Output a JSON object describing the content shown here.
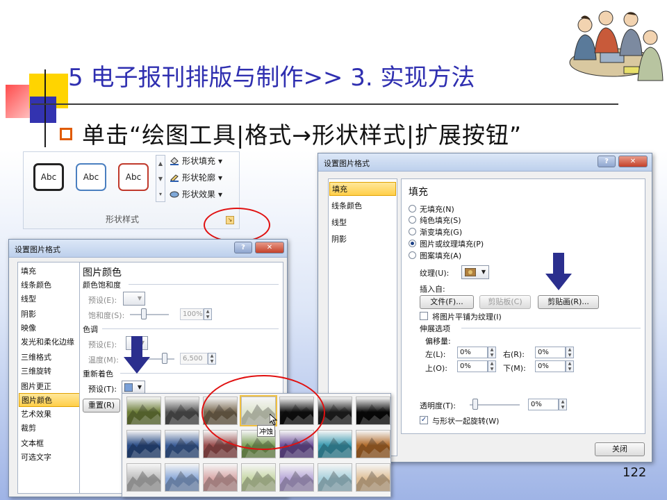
{
  "slide": {
    "title": "5 电子报刊排版与制作>> 3. 实现方法",
    "bullet": "单击“绘图工具|格式→形状样式|扩展按钮”",
    "page_number": "122"
  },
  "ribbon": {
    "style_samples": [
      "Abc",
      "Abc",
      "Abc"
    ],
    "fill_label": "形状填充",
    "outline_label": "形状轮廓",
    "effects_label": "形状效果",
    "group_label": "形状样式",
    "dropdown_glyph": "▾"
  },
  "dialog_right": {
    "title": "设置图片格式",
    "nav": [
      "填充",
      "线条颜色",
      "线型",
      "阴影"
    ],
    "section_title": "填充",
    "radios": [
      {
        "label": "无填充(N)",
        "checked": false
      },
      {
        "label": "纯色填充(S)",
        "checked": false
      },
      {
        "label": "渐变填充(G)",
        "checked": false
      },
      {
        "label": "图片或纹理填充(P)",
        "checked": true
      },
      {
        "label": "图案填充(A)",
        "checked": false
      }
    ],
    "texture_label": "纹理(U):",
    "insert_from_label": "插入自:",
    "file_button": "文件(F)...",
    "clipboard_button": "剪贴板(C)",
    "clipart_button": "剪贴画(R)...",
    "tile_label": "将图片平铺为纹理(I)",
    "stretch_label": "伸展选项",
    "offset_label": "偏移量:",
    "left_label": "左(L):",
    "right_label": "右(R):",
    "top_label": "上(O):",
    "bottom_label": "下(M):",
    "left_value": "0%",
    "right_value": "0%",
    "top_value": "0%",
    "bottom_value": "0%",
    "transparency_label": "透明度(T):",
    "transparency_value": "0%",
    "rotate_label": "与形状一起旋转(W)",
    "close_button": "关闭"
  },
  "dialog_left": {
    "title": "设置图片格式",
    "nav": [
      "填充",
      "线条颜色",
      "线型",
      "阴影",
      "映像",
      "发光和柔化边缘",
      "三维格式",
      "三维旋转",
      "图片更正",
      "图片颜色",
      "艺术效果",
      "裁剪",
      "文本框",
      "可选文字"
    ],
    "selected_nav": "图片颜色",
    "section_title": "图片颜色",
    "saturation_section": "颜色饱和度",
    "preset_p_label": "预设(E):",
    "saturation_label": "饱和度(S):",
    "saturation_value": "100%",
    "tone_section": "色调",
    "preset_e_label": "预设(E):",
    "temperature_label": "温度(M):",
    "temperature_value": "6,500",
    "recolor_section": "重新着色",
    "preset_t_label": "预设(T):",
    "reset_button": "重置(R)"
  },
  "gallery": {
    "tooltip": "冲蚀",
    "rows": [
      [
        "#6e7f3a",
        "#555555",
        "#7a6a52",
        "#dfe5cf",
        "#111111",
        "#222222",
        "#0a0a0a"
      ],
      [
        "#2a4c86",
        "#3a5c96",
        "#9a4f4f",
        "#7fa25a",
        "#6d4f9a",
        "#3b9ab0",
        "#b06a2a"
      ],
      [
        "#bcbcbc",
        "#8aa8d8",
        "#d8a8a8",
        "#c8d8a8",
        "#b8a8d8",
        "#a8d0dc",
        "#e0c098"
      ]
    ]
  },
  "colors": {
    "title_blue": "#2f2fb0",
    "bullet_orange": "#e05a00",
    "highlight_red": "#e01010",
    "arrow_navy": "#2b2f8e"
  }
}
